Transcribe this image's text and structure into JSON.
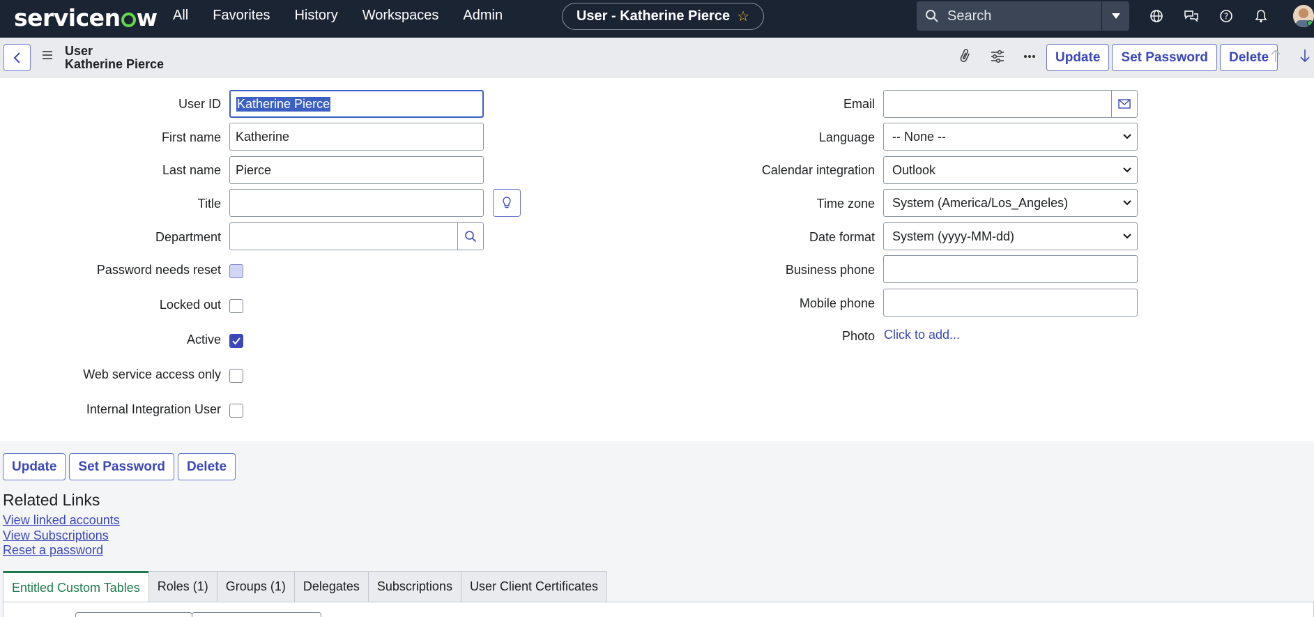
{
  "nav": {
    "logo_pre": "servicen",
    "logo_post": "w",
    "links": [
      "All",
      "Favorites",
      "History",
      "Workspaces",
      "Admin"
    ],
    "record_title": "User - Katherine Pierce",
    "search_label": "Search"
  },
  "header": {
    "record_type": "User",
    "record_name": "Katherine Pierce",
    "buttons": [
      "Update",
      "Set Password",
      "Delete"
    ]
  },
  "form": {
    "left": {
      "user_id_label": "User ID",
      "user_id_value": "Katherine Pierce",
      "first_name_label": "First name",
      "first_name_value": "Katherine",
      "last_name_label": "Last name",
      "last_name_value": "Pierce",
      "title_label": "Title",
      "title_value": "",
      "department_label": "Department",
      "department_value": "",
      "password_reset_label": "Password needs reset",
      "locked_out_label": "Locked out",
      "active_label": "Active",
      "web_service_label": "Web service access only",
      "internal_integration_label": "Internal Integration User"
    },
    "right": {
      "email_label": "Email",
      "email_value": "",
      "language_label": "Language",
      "language_value": "-- None --",
      "calendar_label": "Calendar integration",
      "calendar_value": "Outlook",
      "timezone_label": "Time zone",
      "timezone_value": "System (America/Los_Angeles)",
      "dateformat_label": "Date format",
      "dateformat_value": "System (yyyy-MM-dd)",
      "business_phone_label": "Business phone",
      "business_phone_value": "",
      "mobile_phone_label": "Mobile phone",
      "mobile_phone_value": "",
      "photo_label": "Photo",
      "photo_link": "Click to add..."
    },
    "checkboxes": {
      "password_needs_reset": false,
      "locked_out": false,
      "active": true,
      "web_service_access_only": false,
      "internal_integration_user": false
    }
  },
  "footer": {
    "buttons": [
      "Update",
      "Set Password",
      "Delete"
    ],
    "related_links_title": "Related Links",
    "related_links": [
      "View linked accounts",
      "View Subscriptions",
      "Reset a password"
    ]
  },
  "tabs": [
    "Entitled Custom Tables",
    "Roles (1)",
    "Groups (1)",
    "Delegates",
    "Subscriptions",
    "User Client Certificates"
  ],
  "colors": {
    "nav_bg": "#1b2433",
    "accent": "#3c48b8",
    "logo_green": "#62d84e",
    "active_tab": "#1e7a4d"
  }
}
